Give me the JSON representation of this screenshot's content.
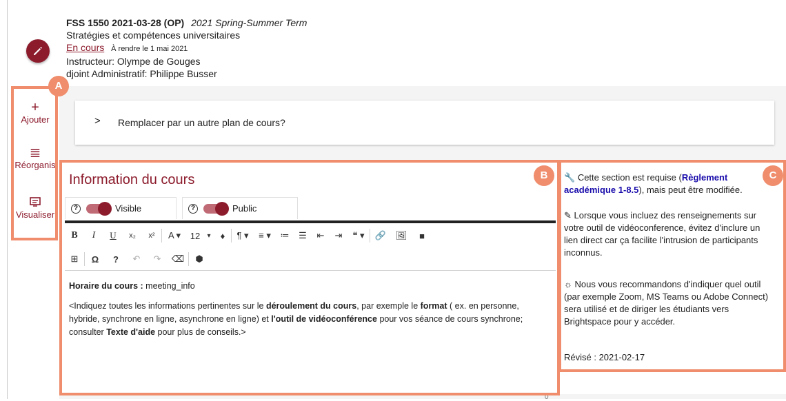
{
  "course": {
    "code": "FSS 1550 2021-03-28 (OP)",
    "term": "2021 Spring-Summer Term",
    "title": "Stratégies et compétences universitaires",
    "status": "En cours",
    "due": "À rendre le 1 mai 2021",
    "instructor": "Instructeur: Olympe de Gouges",
    "assistant": "djoint Administratif: Philippe Busser"
  },
  "sidebar": {
    "items": [
      {
        "label": "Ajouter",
        "icon": "plus-icon"
      },
      {
        "label": "Réorganis",
        "icon": "reorder-icon"
      },
      {
        "label": "Visualiser",
        "icon": "preview-icon"
      }
    ]
  },
  "annotations": {
    "a": "A",
    "b": "B",
    "c": "C"
  },
  "replace": {
    "label": "Remplacer par un autre plan de cours?"
  },
  "section": {
    "title": "Information du cours",
    "visible_label": "Visible",
    "public_label": "Public"
  },
  "toolbar": {
    "font_size": "12",
    "row1": [
      "B",
      "I",
      "U",
      "x₂",
      "x²",
      "A ▾",
      "12",
      "▾",
      "♦",
      "¶ ▾",
      "≡ ▾",
      "≔",
      "☰",
      "⇤",
      "⇥",
      "❝ ▾",
      "🔗",
      "🖼",
      "■"
    ],
    "row2": [
      "⊞",
      "Ω",
      "?",
      "↶",
      "↷",
      "⌫",
      "⬢"
    ]
  },
  "editor": {
    "line1_label": "Horaire du cours :",
    "line1_value": "meeting_info",
    "p1": "<Indiquez toutes les informations pertinentes sur le",
    "p2": "déroulement du cours",
    "p3": ", par exemple le",
    "p4": "format",
    "p5": "( ex. en personne, hybride, synchrone en ligne, asynchrone en ligne) et",
    "p6": "l'outil de vidéoconférence",
    "p7": "pour vos séance de cours synchrone; consulter",
    "p8": "Texte d'aide",
    "p9": "pour plus de conseils.>",
    "char_count": "0"
  },
  "notes": {
    "n1_a": "Cette section est requise (",
    "n1_link": "Règlement académique 1-8.5",
    "n1_b": "), mais peut être modifiée.",
    "n2": "Lorsque vous incluez des renseignements sur votre outil de vidéoconference, évitez d'inclure un lien direct car ça facilite l'intrusion de participants inconnus.",
    "n3": "Nous vous recommandons d'indiquer quel outil (par exemple Zoom, MS Teams ou Adobe Connect) sera utilisé et de diriger les étudiants vers Brightspace pour y accéder.",
    "revised": "Révisé : 2021-02-17"
  },
  "colors": {
    "accent": "#8c1b2c",
    "annotation": "#ef8d6c",
    "link": "#1a0dab"
  }
}
